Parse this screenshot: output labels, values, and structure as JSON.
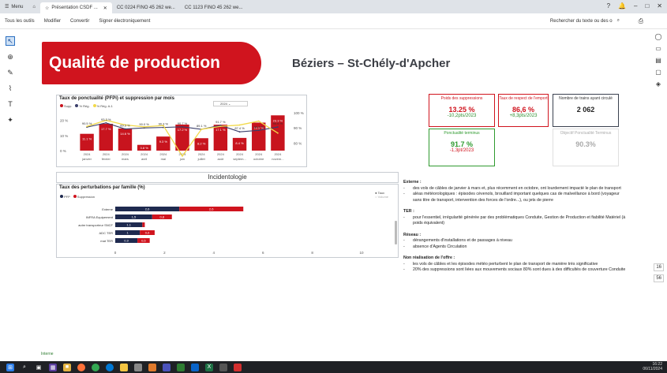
{
  "browser": {
    "menu_label": "Menu",
    "tabs": [
      {
        "label": "Présentation CSDF ...",
        "active": true
      },
      {
        "label": "CC 0224 FINO 45 262 we...",
        "active": false
      },
      {
        "label": "CC 1123 FINO 45 262 we...",
        "active": false
      }
    ]
  },
  "toolbar": {
    "items": [
      "Tous les outils",
      "Modifier",
      "Convertir",
      "Signer électroniquement"
    ],
    "search_label": "Rechercher du texte ou des o"
  },
  "slide": {
    "title": "Qualité de production",
    "subtitle": "Béziers – St-Chély-d'Apcher",
    "footer": "Interne",
    "kpis": [
      {
        "label": "Poids des suppressions",
        "value": "13.25 %",
        "delta": "-10,2pts/2023",
        "border": "#d0141e",
        "label_color": "#d0141e",
        "value_color": "#d0141e",
        "delta_color": "#2f8f2f"
      },
      {
        "label": "Taux de respect de l'emport",
        "value": "86,6 %",
        "delta": "+8,3pts/2023",
        "border": "#d0141e",
        "label_color": "#d0141e",
        "value_color": "#d0141e",
        "delta_color": "#2f8f2f"
      },
      {
        "label": "Nombre de trains ayant circulé",
        "value": "2 062",
        "delta": "",
        "border": "#3b4250",
        "label_color": "#333",
        "value_color": "#222",
        "delta_color": "#333"
      },
      {
        "label": "Ponctualité terminus",
        "value": "91.7 %",
        "delta": "-1,3pt/2023",
        "border": "#2f9a2f",
        "label_color": "#2f9a2f",
        "value_color": "#2f9a2f",
        "delta_color": "#d0141e"
      },
      {
        "label": "Objectif Ponctualité Terminus",
        "value": "90.3%",
        "delta": "",
        "border": "#e0e0e0",
        "label_color": "#aaa",
        "value_color": "#aaa",
        "delta_color": "#aaa"
      }
    ],
    "incid_title": "Incidentologie",
    "notes": [
      {
        "heading": "Externe :",
        "bullets": [
          "des vols de câbles de janvier à mars et, plus récemment en octobre, ont lourdement impacté le plan de transport",
          "aléas météorologiques : épisodes cévenols, brouillard important quelques cas de malveillance à bord (voyageur sans titre de transport, intervention des forces de l'ordre...), ou jets de pierre"
        ]
      },
      {
        "heading": "TER :",
        "bullets": [
          "pour l'essentiel, irrégularité générée par des problématiques Conduite, Gestion de Production et fiabilité Matériel (à poids équivalent)"
        ]
      },
      {
        "heading": "Réseau :",
        "bullets": [
          "dérangements d'installations et de passages à niveau",
          "absence d'Agents Circulation"
        ]
      },
      {
        "heading": "Non réalisation de l'offre :",
        "bullets": [
          "les vols de câbles et les épisodes météo perturbent le plan de transport de manière très significative",
          "20% des suppressions sont liées aux mouvements sociaux 80% sont dues à des difficultés de couverture Conduite"
        ]
      }
    ]
  },
  "chart_data": [
    {
      "type": "bar",
      "title": "Taux de ponctualité (PFPi) et suppression par mois",
      "year_filter": "2024",
      "legend": [
        "Supp.",
        "% Rég.",
        "% Rég. A-1"
      ],
      "categories": [
        "2024 janvier",
        "2024 février",
        "2024 mars",
        "2024 avril",
        "2024 mai",
        "2024 juin",
        "2024 juillet",
        "2024 août",
        "2024 septem...",
        "2024 octobre",
        "2024 novem..."
      ],
      "tick_labels": [
        "janvier",
        "février",
        "mars",
        "avril",
        "mai",
        "juin",
        "juillet",
        "août",
        "septem...",
        "octobre",
        "novem..."
      ],
      "series": [
        {
          "name": "Supp.",
          "values": [
            11.1,
            17.7,
            14.6,
            3.8,
            9.3,
            17.2,
            8.2,
            17.1,
            8.4,
            18.5,
            23.3
          ],
          "color": "#c8141e"
        },
        {
          "name": "% Rég.",
          "values": [
            90.5,
            93.3,
            89.3,
            90.0,
            90.3,
            90.7,
            89.1,
            91.7,
            87.4,
            88.4,
            90.6
          ],
          "color": "#3b3f6b"
        },
        {
          "name": "% Rég. A-1",
          "values": [
            91.0,
            95.0,
            92.0,
            90.7,
            91.6,
            71.4,
            89.1,
            91.0,
            91.9,
            94.5,
            86.6
          ],
          "color": "#f2d94a"
        }
      ],
      "supp_labels": [
        "11.1 %",
        "17.7 %",
        "14.6 %",
        "3.8 %",
        "9.3 %",
        "17.2 %",
        "8.2 %",
        "17.1 %",
        "8.4 %",
        "18.5 %",
        "23.3 %"
      ],
      "reg_labels": [
        "90.5 %",
        "93.3 %",
        "89.3 %",
        "90.0 %",
        "90.3 %",
        "90.7 %",
        "89.1 %",
        "91.7 %",
        "87.4 %",
        "88.4 %",
        "90.6 %"
      ],
      "y_left_ticks": [
        "20 %",
        "10 %",
        "0 %"
      ],
      "y_right_ticks": [
        "100 %",
        "90 %",
        "80 %"
      ],
      "ylim_left": [
        0,
        25
      ],
      "ylim_right": [
        75,
        100
      ]
    },
    {
      "type": "bar",
      "title": "Taux des perturbations par famille (%)",
      "toggle_options": [
        "Taux",
        "Volume"
      ],
      "legend": [
        "PFP",
        "Suppression"
      ],
      "categories": [
        "Externe",
        "INFRA Equipement",
        "autre transporteur SNCF",
        "ADC TER",
        "mat TER"
      ],
      "series": [
        {
          "name": "PFP",
          "values": [
            2.6,
            1.5,
            1.1,
            1.0,
            0.9
          ],
          "color": "#1f2a4f"
        },
        {
          "name": "Suppression",
          "values": [
            2.6,
            0.8,
            0.1,
            0.6,
            0.5
          ],
          "color": "#d0141e"
        }
      ],
      "value_labels": [
        [
          "2,6",
          "2,6"
        ],
        [
          "1,5",
          "0,8"
        ],
        [
          "1,1",
          ""
        ],
        [
          "1",
          "0,6"
        ],
        [
          "0,9",
          "0,5"
        ]
      ],
      "x_ticks": [
        "0",
        "2",
        "4",
        "6",
        "8",
        "10"
      ],
      "xlim": [
        0,
        10
      ]
    }
  ]
}
